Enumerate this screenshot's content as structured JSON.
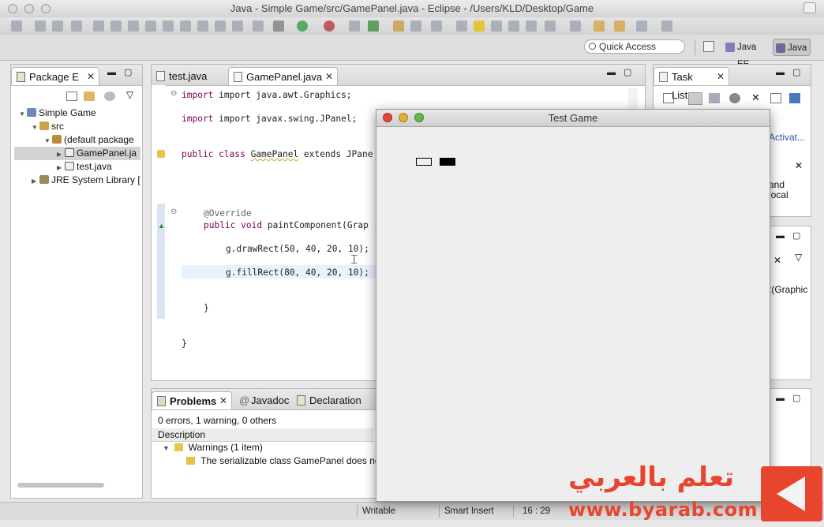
{
  "window": {
    "title": "Java - Simple Game/src/GamePanel.java - Eclipse - /Users/KLD/Desktop/Game"
  },
  "toolbar": {
    "quick_access": "Quick Access",
    "perspectives": [
      "Java EE",
      "Java"
    ]
  },
  "package_explorer": {
    "tab_label": "Package E",
    "tree": [
      {
        "label": "Simple Game",
        "depth": 0,
        "icon": "project-icon"
      },
      {
        "label": "src",
        "depth": 1,
        "icon": "source-folder-icon"
      },
      {
        "label": "(default package",
        "depth": 2,
        "icon": "package-icon"
      },
      {
        "label": "GamePanel.ja",
        "depth": 3,
        "icon": "java-file-icon",
        "selected": true
      },
      {
        "label": "test.java",
        "depth": 3,
        "icon": "java-file-icon"
      },
      {
        "label": "JRE System Library [",
        "depth": 1,
        "icon": "library-icon"
      }
    ]
  },
  "editor": {
    "tabs": [
      "test.java",
      "GamePanel.java"
    ],
    "active_tab": "GamePanel.java",
    "code": {
      "l1": "import java.awt.Graphics;",
      "l2": "import javax.swing.JPanel;",
      "l3_kw": "public class ",
      "l3_name": "GamePanel",
      "l3_rest": " extends JPane",
      "l4": "@Override",
      "l5_kw": "public void ",
      "l5_rest": "paintComponent(Grap",
      "l6": "g.drawRect(50, 40, 20, 10);",
      "l7": "g.fillRect(80, 40, 20, 10);",
      "l8": "}",
      "l9": "}"
    }
  },
  "task_list": {
    "tab_label": "Task List",
    "fragments": [
      "Activat...",
      "and",
      "local"
    ]
  },
  "outline": {
    "fragment": "t(Graphic"
  },
  "problems": {
    "tabs": [
      "Problems",
      "Javadoc",
      "Declaration"
    ],
    "summary": "0 errors, 1 warning, 0 others",
    "column": "Description",
    "group": "Warnings (1 item)",
    "item": "The serializable class GamePanel does not"
  },
  "status": {
    "writable": "Writable",
    "insert_mode": "Smart Insert",
    "position": "16 : 29"
  },
  "game_window": {
    "title": "Test Game"
  },
  "watermark": {
    "arabic": "تعلم بالعربي",
    "url": "www.byarab.com"
  }
}
